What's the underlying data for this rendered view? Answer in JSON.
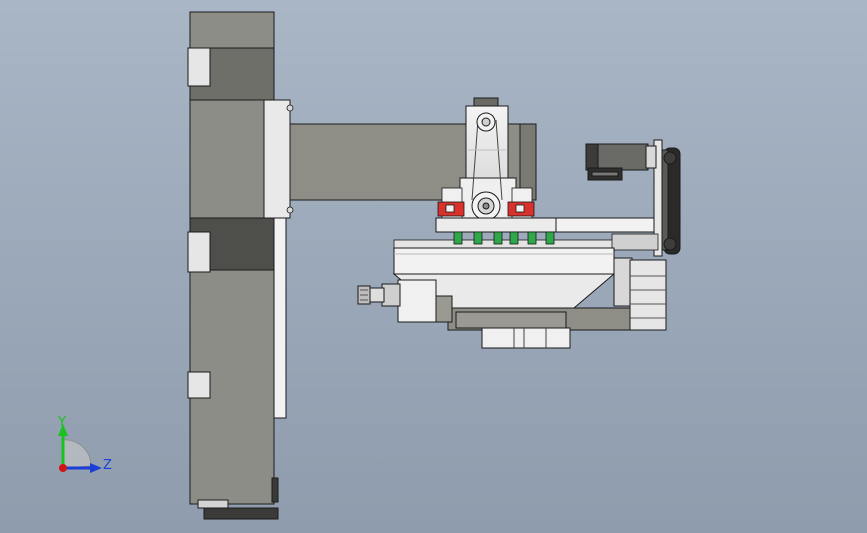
{
  "view": {
    "background_top": "#a9b6c6",
    "background_bottom": "#8f9cad"
  },
  "triad": {
    "y_label": "Y",
    "z_label": "Z",
    "y_color": "#19c21c",
    "z_color": "#1b3fd6",
    "x_color": "#d11414"
  },
  "colors": {
    "body_grey": "#8c8c85",
    "light_panel": "#ebebeb",
    "dark_grey": "#5e5e5a",
    "outline": "#1a1a1a",
    "rail_green": "#2fa84a",
    "block_red": "#d9312b"
  }
}
